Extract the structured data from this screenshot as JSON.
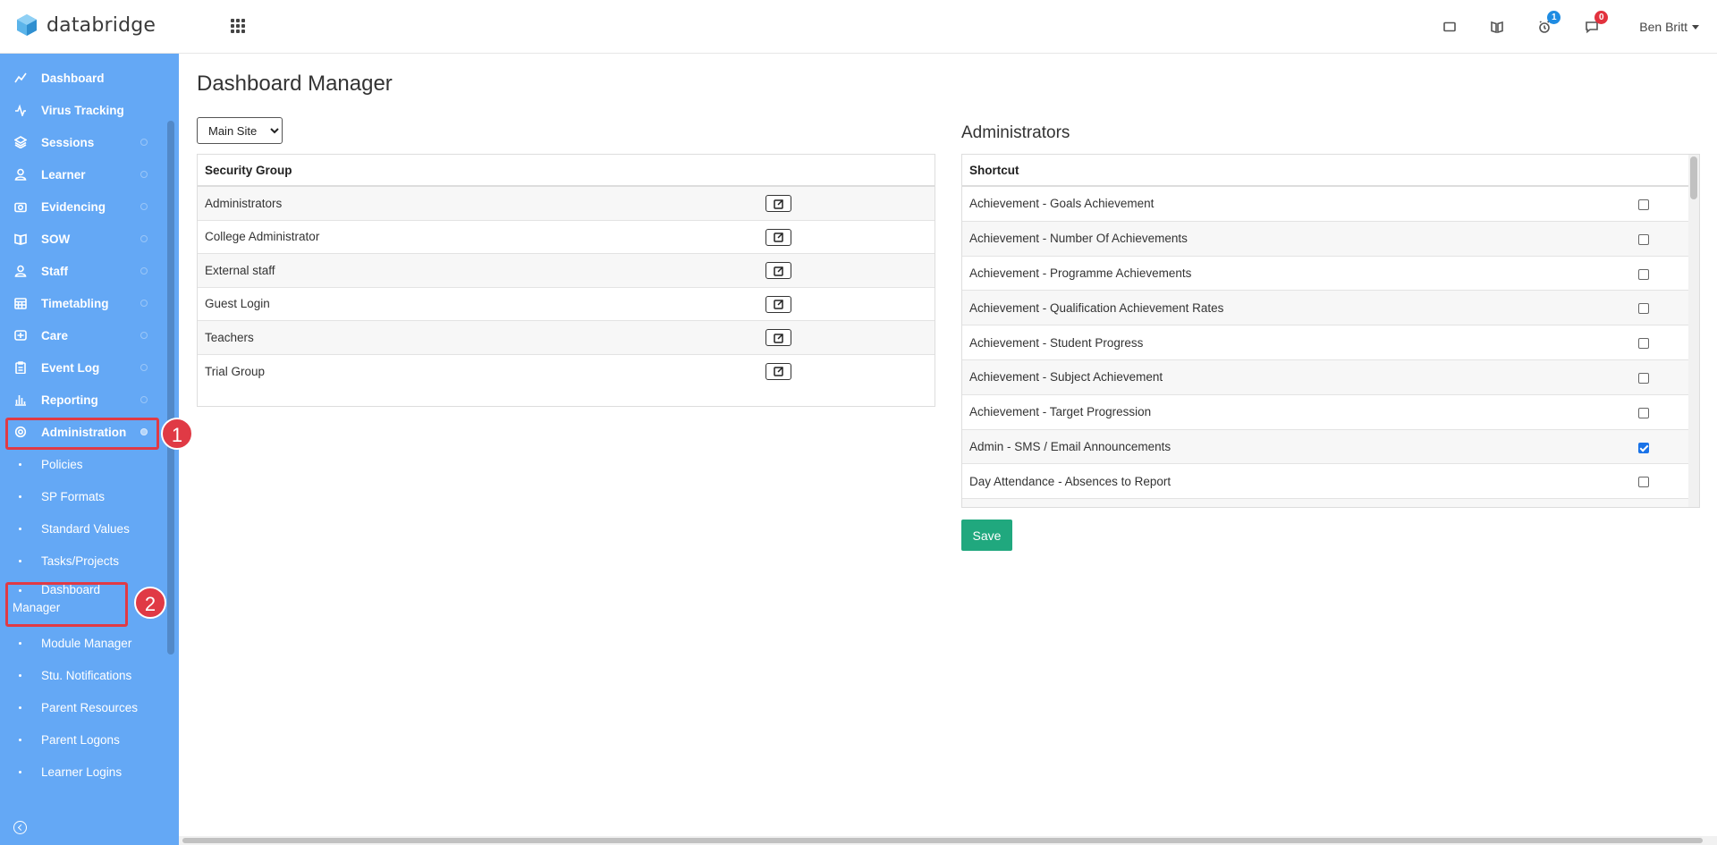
{
  "brand": {
    "name": "databridge",
    "color": "#3a9ad9"
  },
  "topbar": {
    "notifications_badge": "1",
    "messages_badge": "0",
    "user_name": "Ben Britt"
  },
  "sidebar": {
    "items": [
      {
        "label": "Dashboard",
        "icon": "chart-line-icon"
      },
      {
        "label": "Virus Tracking",
        "icon": "pulse-icon"
      },
      {
        "label": "Sessions",
        "icon": "layers-icon"
      },
      {
        "label": "Learner",
        "icon": "user-icon"
      },
      {
        "label": "Evidencing",
        "icon": "camera-icon"
      },
      {
        "label": "SOW",
        "icon": "book-icon"
      },
      {
        "label": "Staff",
        "icon": "user-icon"
      },
      {
        "label": "Timetabling",
        "icon": "calendar-icon"
      },
      {
        "label": "Care",
        "icon": "care-icon"
      },
      {
        "label": "Event Log",
        "icon": "clipboard-icon"
      },
      {
        "label": "Reporting",
        "icon": "bar-chart-icon"
      },
      {
        "label": "Administration",
        "icon": "gear-icon"
      }
    ],
    "admin_subitems": [
      "Policies",
      "SP Formats",
      "Standard Values",
      "Tasks/Projects",
      "Dashboard Manager",
      "Module Manager",
      "Stu. Notifications",
      "Parent Resources",
      "Parent Logons",
      "Learner Logins"
    ]
  },
  "annotations": {
    "marker_1": "1",
    "marker_2": "2",
    "color": "#e03a45"
  },
  "main": {
    "title": "Dashboard Manager",
    "site_select": {
      "value": "Main Site"
    },
    "security_groups": {
      "header": "Security Group",
      "rows": [
        "Administrators",
        "College Administrator",
        "External staff",
        "Guest Login",
        "Teachers",
        "Trial Group"
      ]
    },
    "admin_panel": {
      "title": "Administrators",
      "header": "Shortcut",
      "rows": [
        {
          "label": "Achievement - Goals Achievement",
          "checked": false
        },
        {
          "label": "Achievement - Number Of Achievements",
          "checked": false
        },
        {
          "label": "Achievement - Programme Achievements",
          "checked": false
        },
        {
          "label": "Achievement - Qualification Achievement Rates",
          "checked": false
        },
        {
          "label": "Achievement - Student Progress",
          "checked": false
        },
        {
          "label": "Achievement - Subject Achievement",
          "checked": false
        },
        {
          "label": "Achievement - Target Progression",
          "checked": false
        },
        {
          "label": "Admin - SMS / Email Announcements",
          "checked": true
        },
        {
          "label": "Day Attendance - Absences to Report",
          "checked": false
        },
        {
          "label": "",
          "checked": false
        }
      ]
    },
    "save_label": "Save",
    "save_color": "#20a87e"
  }
}
